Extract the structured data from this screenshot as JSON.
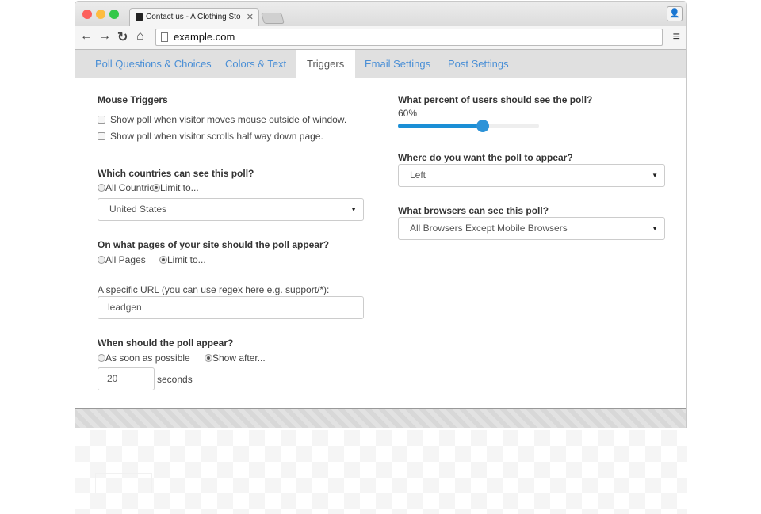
{
  "browser": {
    "tab_title": "Contact us - A Clothing Sto",
    "url": "example.com"
  },
  "tabs": [
    {
      "label": "Poll Questions & Choices"
    },
    {
      "label": "Colors & Text"
    },
    {
      "label": "Triggers",
      "active": true
    },
    {
      "label": "Email Settings"
    },
    {
      "label": "Post Settings"
    }
  ],
  "mouse": {
    "heading": "Mouse Triggers",
    "opt1": "Show poll when visitor moves mouse outside of window.",
    "opt2": "Show poll when visitor scrolls half way down page.",
    "opt1_checked": false,
    "opt2_checked": false
  },
  "countries": {
    "heading": "Which countries can see this poll?",
    "all": "All Countries",
    "limit": "Limit to...",
    "selected": "limit",
    "value": "United States"
  },
  "pages": {
    "heading": "On what pages of your site should the poll appear?",
    "all": "All Pages",
    "limit": "Limit to...",
    "selected": "limit",
    "url_label": "A specific URL (you can use regex here e.g. support/*):",
    "url_value": "leadgen"
  },
  "when": {
    "heading": "When should the poll appear?",
    "asap": "As soon as possible",
    "after": "Show after...",
    "selected": "after",
    "seconds_value": "20",
    "seconds_label": "seconds"
  },
  "percent": {
    "heading": "What percent of users should see the poll?",
    "value_label": "60%",
    "value": 60
  },
  "position": {
    "heading": "Where do you want the poll to appear?",
    "value": "Left"
  },
  "browsers": {
    "heading": "What browsers can see this poll?",
    "value": "All Browsers Except Mobile Browsers"
  },
  "colors": {
    "accent": "#1b8fd6",
    "tab_link": "#4a8fd6"
  }
}
